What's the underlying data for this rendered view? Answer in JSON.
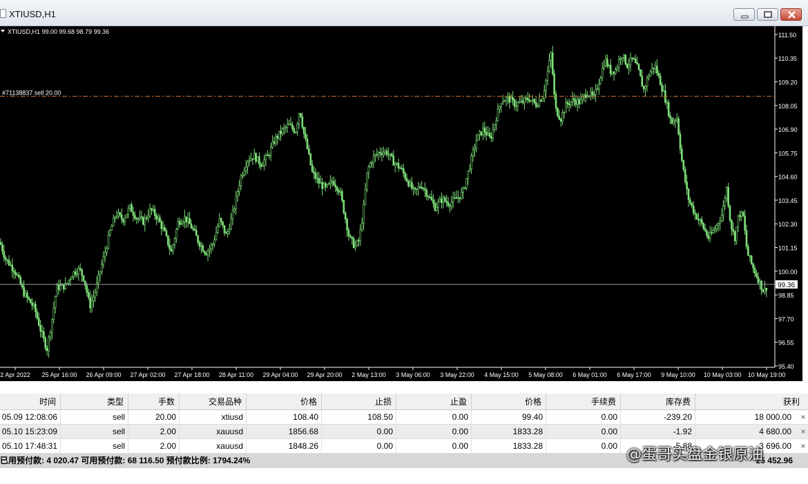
{
  "window": {
    "title": "XTIUSD,H1",
    "buttons": [
      "minimize-icon",
      "restore-icon",
      "close-icon"
    ]
  },
  "chart": {
    "info_line": "XTIUSD,H1  99.00 99.68 98.79 99.36",
    "order_label": "#71138837 sell 20.00",
    "bid_label": "99.36"
  },
  "chart_data": {
    "type": "candlestick",
    "symbol": "XTIUSD",
    "timeframe": "H1",
    "ohlc_last": {
      "open": 99.0,
      "high": 99.68,
      "low": 98.79,
      "close": 99.36
    },
    "current_price": 99.36,
    "order_line": {
      "label": "#71138837 sell 20.00",
      "price": 108.5
    },
    "ylim": [
      95.4,
      111.8
    ],
    "y_ticks": [
      111.5,
      110.35,
      109.2,
      108.05,
      106.9,
      105.75,
      104.6,
      103.45,
      102.3,
      101.15,
      100.0,
      98.85,
      97.7,
      96.55,
      95.4
    ],
    "x_ticks": [
      "2 Apr 2022",
      "25 Apr 16:00",
      "26 Apr 09:00",
      "27 Apr 02:00",
      "27 Apr 18:00",
      "28 Apr 11:00",
      "29 Apr 04:00",
      "29 Apr 20:00",
      "2 May 13:00",
      "3 May 06:00",
      "3 May 22:00",
      "4 May 15:00",
      "5 May 08:00",
      "6 May 01:00",
      "6 May 17:00",
      "9 May 10:00",
      "10 May 03:00",
      "10 May 19:00"
    ],
    "price_path": [
      [
        0,
        101.4
      ],
      [
        8,
        100.6
      ],
      [
        22,
        100.0
      ],
      [
        35,
        98.9
      ],
      [
        50,
        98.2
      ],
      [
        60,
        97.0
      ],
      [
        68,
        96.2
      ],
      [
        75,
        97.6
      ],
      [
        82,
        99.2
      ],
      [
        95,
        99.3
      ],
      [
        105,
        99.9
      ],
      [
        115,
        100.1
      ],
      [
        122,
        99.6
      ],
      [
        130,
        98.3
      ],
      [
        137,
        98.9
      ],
      [
        145,
        100.0
      ],
      [
        152,
        100.9
      ],
      [
        160,
        102.0
      ],
      [
        168,
        102.8
      ],
      [
        178,
        102.5
      ],
      [
        188,
        103.1
      ],
      [
        198,
        102.6
      ],
      [
        208,
        102.4
      ],
      [
        218,
        103.0
      ],
      [
        228,
        102.6
      ],
      [
        238,
        101.9
      ],
      [
        248,
        100.9
      ],
      [
        258,
        102.4
      ],
      [
        268,
        102.6
      ],
      [
        278,
        102.1
      ],
      [
        288,
        101.4
      ],
      [
        298,
        100.9
      ],
      [
        308,
        101.3
      ],
      [
        318,
        102.5
      ],
      [
        328,
        101.7
      ],
      [
        338,
        102.9
      ],
      [
        348,
        104.5
      ],
      [
        358,
        105.4
      ],
      [
        368,
        105.6
      ],
      [
        378,
        105.2
      ],
      [
        388,
        105.6
      ],
      [
        398,
        106.4
      ],
      [
        408,
        106.8
      ],
      [
        418,
        107.1
      ],
      [
        428,
        106.8
      ],
      [
        434,
        107.9
      ],
      [
        440,
        106.7
      ],
      [
        446,
        105.8
      ],
      [
        452,
        104.8
      ],
      [
        462,
        104.3
      ],
      [
        472,
        104.0
      ],
      [
        482,
        104.4
      ],
      [
        492,
        103.9
      ],
      [
        500,
        102.6
      ],
      [
        506,
        101.6
      ],
      [
        514,
        101.2
      ],
      [
        520,
        101.5
      ],
      [
        526,
        102.9
      ],
      [
        532,
        104.9
      ],
      [
        540,
        105.5
      ],
      [
        550,
        105.8
      ],
      [
        560,
        105.8
      ],
      [
        570,
        105.3
      ],
      [
        580,
        105.0
      ],
      [
        590,
        104.4
      ],
      [
        600,
        103.8
      ],
      [
        610,
        104.2
      ],
      [
        620,
        103.7
      ],
      [
        630,
        103.1
      ],
      [
        640,
        103.5
      ],
      [
        650,
        103.3
      ],
      [
        660,
        103.5
      ],
      [
        670,
        103.8
      ],
      [
        680,
        105.1
      ],
      [
        690,
        106.4
      ],
      [
        700,
        106.9
      ],
      [
        710,
        106.4
      ],
      [
        718,
        107.4
      ],
      [
        726,
        108.3
      ],
      [
        736,
        108.4
      ],
      [
        746,
        108.1
      ],
      [
        756,
        108.2
      ],
      [
        766,
        108.4
      ],
      [
        776,
        108.1
      ],
      [
        786,
        108.5
      ],
      [
        792,
        109.5
      ],
      [
        798,
        110.6
      ],
      [
        804,
        107.9
      ],
      [
        812,
        107.4
      ],
      [
        820,
        108.1
      ],
      [
        830,
        108.3
      ],
      [
        840,
        108.2
      ],
      [
        850,
        108.7
      ],
      [
        860,
        108.4
      ],
      [
        868,
        109.3
      ],
      [
        876,
        110.3
      ],
      [
        884,
        109.7
      ],
      [
        892,
        109.8
      ],
      [
        900,
        110.6
      ],
      [
        908,
        110.0
      ],
      [
        916,
        110.3
      ],
      [
        924,
        109.8
      ],
      [
        932,
        108.8
      ],
      [
        940,
        109.6
      ],
      [
        948,
        110.0
      ],
      [
        956,
        109.2
      ],
      [
        964,
        108.3
      ],
      [
        972,
        107.2
      ],
      [
        980,
        107.5
      ],
      [
        988,
        105.2
      ],
      [
        996,
        103.6
      ],
      [
        1006,
        102.8
      ],
      [
        1016,
        102.3
      ],
      [
        1026,
        101.6
      ],
      [
        1036,
        102.1
      ],
      [
        1046,
        102.8
      ],
      [
        1052,
        104.1
      ],
      [
        1058,
        102.3
      ],
      [
        1064,
        101.6
      ],
      [
        1070,
        102.8
      ],
      [
        1076,
        102.7
      ],
      [
        1082,
        100.9
      ],
      [
        1090,
        100.2
      ],
      [
        1098,
        99.6
      ],
      [
        1106,
        99.0
      ],
      [
        1112,
        99.36
      ]
    ]
  },
  "table": {
    "columns": [
      "时间",
      "类型",
      "手数",
      "交易品种",
      "价格",
      "止损",
      "止盈",
      "价格",
      "手续费",
      "库存费",
      "获利"
    ],
    "rows": [
      [
        "05.09 12:08:06",
        "sell",
        "20.00",
        "xtiusd",
        "108.40",
        "108.50",
        "0.00",
        "99.40",
        "0.00",
        "-239.20",
        "18 000.00"
      ],
      [
        "05.10 15:23:09",
        "sell",
        "2.00",
        "xauusd",
        "1856.68",
        "0.00",
        "0.00",
        "1833.28",
        "0.00",
        "-1.92",
        "4 680.00"
      ],
      [
        "05.10 17:48:31",
        "sell",
        "2.00",
        "xauusd",
        "1848.26",
        "0.00",
        "0.00",
        "1833.28",
        "0.00",
        "-5.88",
        "3 696.00"
      ]
    ],
    "close_symbol": "×"
  },
  "summary": {
    "left": "已用预付款: 4 020.47  可用预付款: 68 116.50  预付款比例: 1794.24%",
    "right": "25 452.96"
  },
  "watermark": "@蛋哥实盘金银原油",
  "colors": {
    "background": "#000000",
    "candle": "#7fe07a",
    "grid_axis": "#ffffff",
    "order_line": "#d9722b",
    "bid_line": "#a0a0a0"
  }
}
